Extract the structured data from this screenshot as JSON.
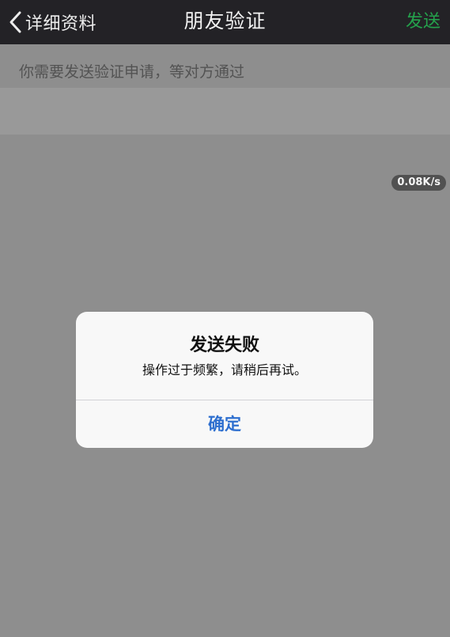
{
  "navbar": {
    "back_label": "详细资料",
    "title": "朋友验证",
    "action_label": "发送",
    "back_icon": "chevron-left-icon"
  },
  "content": {
    "hint": "你需要发送验证申请，等对方通过",
    "request_value": ""
  },
  "status": {
    "network_speed": "0.08K/s"
  },
  "alert": {
    "title": "发送失败",
    "message": "操作过于频繁，请稍后再试。",
    "confirm_label": "确定"
  },
  "colors": {
    "navbar_bg": "#232226",
    "action_green": "#24a24c",
    "alert_button_blue": "#2e6fcf"
  }
}
